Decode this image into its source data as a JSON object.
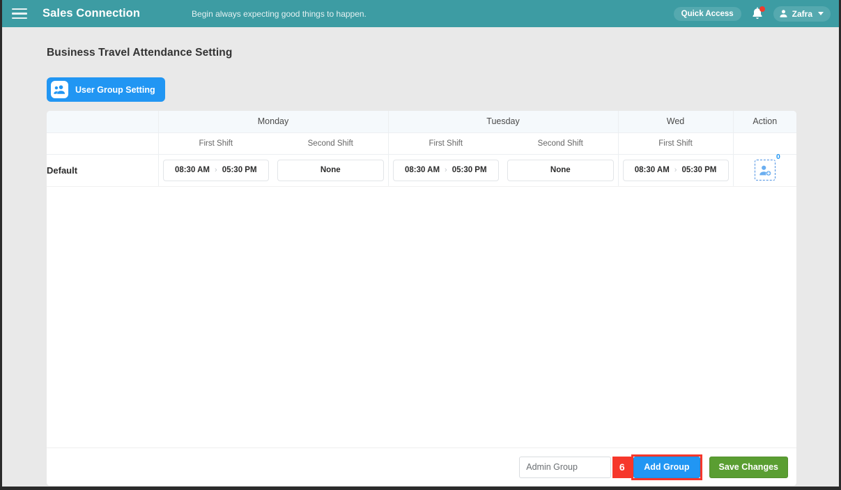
{
  "topbar": {
    "menu_icon": "hamburger-icon",
    "brand": "Sales Connection",
    "tagline": "Begin always expecting good things to happen.",
    "quick_access_label": "Quick Access",
    "bell_icon": "notification-bell-icon",
    "bell_has_badge": true,
    "user_name": "Zafra",
    "user_icon": "person-icon",
    "caret_icon": "chevron-down-icon",
    "bg_color": "#3d9ca3",
    "pill_color": "#55a9af",
    "badge_color": "#ef3b2d"
  },
  "page": {
    "title": "Business Travel Attendance Setting",
    "user_group_button": {
      "label": "User Group Setting",
      "icon": "user-group-icon",
      "color": "#2196f3"
    }
  },
  "table": {
    "day_headers": [
      "",
      "Monday",
      "Tuesday",
      "Wed",
      "Action"
    ],
    "shift_headers": [
      "",
      "First Shift",
      "Second Shift",
      "First Shift",
      "Second Shift",
      "First Shift",
      ""
    ],
    "rows": [
      {
        "group": "Default",
        "cells": [
          {
            "type": "range",
            "start": "08:30 AM",
            "end": "05:30 PM",
            "separator": "›"
          },
          {
            "type": "none",
            "text": "None"
          },
          {
            "type": "range",
            "start": "08:30 AM",
            "end": "05:30 PM",
            "separator": "›"
          },
          {
            "type": "none",
            "text": "None"
          },
          {
            "type": "range",
            "start": "08:30 AM",
            "end": "05:30 PM",
            "separator": "›"
          }
        ],
        "action": {
          "icon": "add-user-icon",
          "count": "0"
        }
      }
    ]
  },
  "footer": {
    "group_input_value": "Admin Group",
    "group_input_placeholder": "Admin Group",
    "step_marker": "6",
    "add_group_label": "Add Group",
    "save_changes_label": "Save Changes",
    "annotation_color": "#f6372b",
    "add_group_color": "#2196f3",
    "save_color": "#5a9e32"
  }
}
